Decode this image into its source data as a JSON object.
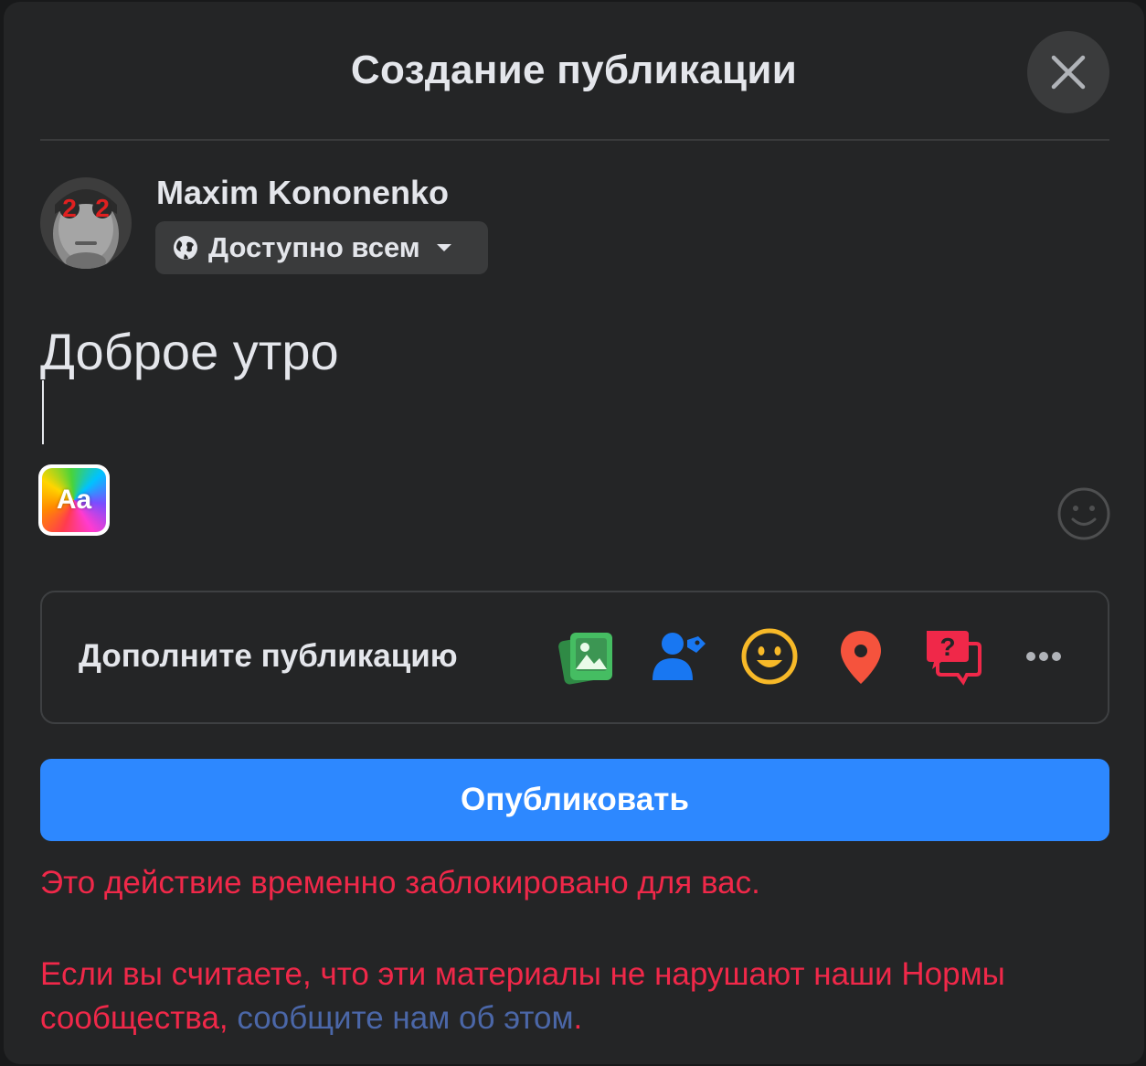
{
  "dialog": {
    "title": "Создание публикации",
    "close_icon": "close-icon"
  },
  "author": {
    "name": "Maxim Kononenko",
    "avatar_icon": "user-avatar",
    "audience": {
      "icon": "globe-icon",
      "label": "Доступно всем",
      "caret_icon": "caret-down-icon"
    }
  },
  "composer": {
    "text": "Доброе утро",
    "text_style_label": "Aa",
    "emoji_icon": "smiley-icon"
  },
  "addons": {
    "label": "Дополните публикацию",
    "items": [
      {
        "name": "photo-video",
        "icon": "photo-icon",
        "color": "#45bd62"
      },
      {
        "name": "tag-people",
        "icon": "tag-people-icon",
        "color": "#1877f2"
      },
      {
        "name": "feeling-activity",
        "icon": "smiley-icon",
        "color": "#f7b928"
      },
      {
        "name": "check-in",
        "icon": "location-pin-icon",
        "color": "#f5533d"
      },
      {
        "name": "ask-question",
        "icon": "question-chat-icon",
        "color": "#f02849"
      },
      {
        "name": "more",
        "icon": "more-dots-icon",
        "color": "#b0b3b8"
      }
    ]
  },
  "actions": {
    "publish_label": "Опубликовать"
  },
  "messages": {
    "error": "Это действие временно заблокировано для вас.",
    "note_prefix": "Если вы считаете, что эти материалы не нарушают наши Нормы сообщества, ",
    "note_link": "сообщите нам об этом",
    "note_suffix": "."
  },
  "colors": {
    "background": "#242526",
    "accent": "#2d88ff",
    "error": "#f02849",
    "link": "#4b67a8"
  }
}
